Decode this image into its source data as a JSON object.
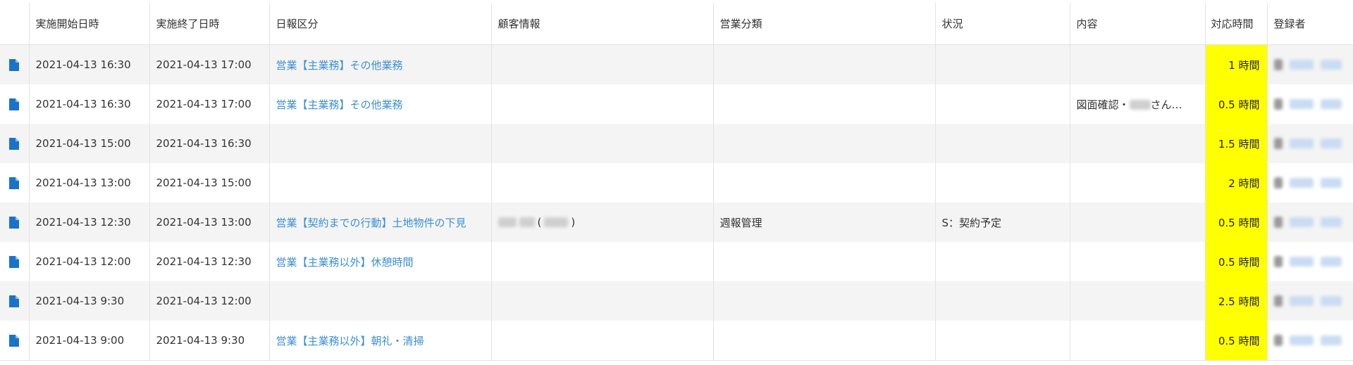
{
  "table": {
    "headers": {
      "start": "実施開始日時",
      "end": "実施終了日時",
      "category": "日報区分",
      "customer": "顧客情報",
      "sales_type": "営業分類",
      "status": "状況",
      "content": "内容",
      "hours": "対応時間",
      "registrant": "登録者"
    },
    "rows": [
      {
        "start": "2021-04-13 16:30",
        "end": "2021-04-13 17:00",
        "category": "営業【主業務】その他業務",
        "customer": "",
        "sales_type": "",
        "status": "",
        "content": "",
        "hours": "1 時間"
      },
      {
        "start": "2021-04-13 16:30",
        "end": "2021-04-13 17:00",
        "category": "営業【主業務】その他業務",
        "customer": "",
        "sales_type": "",
        "status": "",
        "content_prefix": "図面確認・",
        "content_suffix": "さん…",
        "hours": "0.5 時間"
      },
      {
        "start": "2021-04-13 15:00",
        "end": "2021-04-13 16:30",
        "category": "",
        "customer": "",
        "sales_type": "",
        "status": "",
        "content": "",
        "hours": "1.5 時間"
      },
      {
        "start": "2021-04-13 13:00",
        "end": "2021-04-13 15:00",
        "category": "",
        "customer": "",
        "sales_type": "",
        "status": "",
        "content": "",
        "hours": "2 時間"
      },
      {
        "start": "2021-04-13 12:30",
        "end": "2021-04-13 13:00",
        "category": "営業【契約までの行動】土地物件の下見",
        "customer_open": "(",
        "customer_close": ")",
        "sales_type": "週報管理",
        "status": "S：契約予定",
        "content": "",
        "hours": "0.5 時間"
      },
      {
        "start": "2021-04-13 12:00",
        "end": "2021-04-13 12:30",
        "category": "営業【主業務以外】休憩時間",
        "customer": "",
        "sales_type": "",
        "status": "",
        "content": "",
        "hours": "0.5 時間"
      },
      {
        "start": "2021-04-13 9:30",
        "end": "2021-04-13 12:00",
        "category": "",
        "customer": "",
        "sales_type": "",
        "status": "",
        "content": "",
        "hours": "2.5 時間"
      },
      {
        "start": "2021-04-13 9:00",
        "end": "2021-04-13 9:30",
        "category": "営業【主業務以外】朝礼・清掃",
        "customer": "",
        "sales_type": "",
        "status": "",
        "content": "",
        "hours": "0.5 時間"
      }
    ]
  },
  "icons": {
    "row_icon": "document-icon"
  },
  "colors": {
    "link": "#3b8fd3",
    "hours_highlight": "#ffff00",
    "icon": "#1a73c8"
  }
}
